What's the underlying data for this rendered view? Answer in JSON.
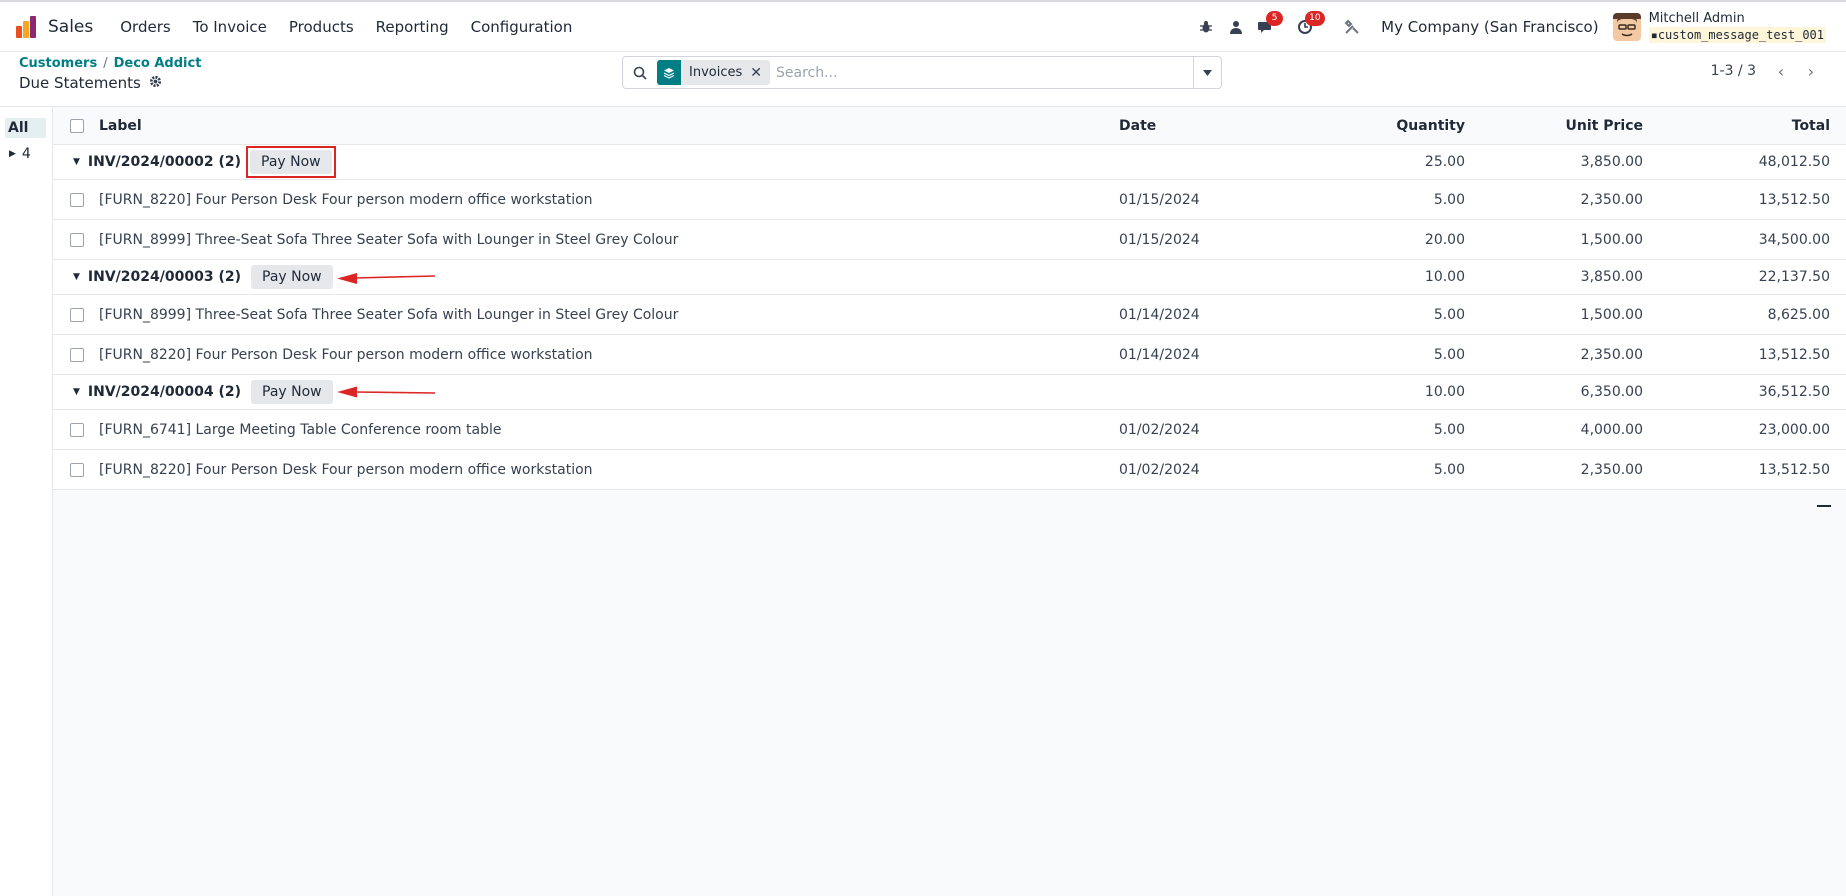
{
  "navbar": {
    "app_name": "Sales",
    "menu": [
      "Orders",
      "To Invoice",
      "Products",
      "Reporting",
      "Configuration"
    ],
    "messages_badge": "5",
    "activities_badge": "10",
    "company": "My Company (San Francisco)",
    "user_name": "Mitchell Admin",
    "database": "custom_message_test_001"
  },
  "control": {
    "breadcrumb": [
      "Customers",
      "Deco Addict"
    ],
    "title": "Due Statements",
    "facet_label": "Invoices",
    "search_placeholder": "Search...",
    "pager": "1-3 / 3"
  },
  "side": {
    "all_label": "All",
    "items": [
      "4"
    ]
  },
  "table": {
    "headers": {
      "label": "Label",
      "date": "Date",
      "quantity": "Quantity",
      "unit_price": "Unit Price",
      "total": "Total"
    },
    "pay_label": "Pay Now",
    "groups": [
      {
        "name": "INV/2024/00002 (2)",
        "quantity": "25.00",
        "unit_price": "3,850.00",
        "total": "48,012.50",
        "rows": [
          {
            "label": "[FURN_8220] Four Person Desk Four person modern office workstation",
            "date": "01/15/2024",
            "quantity": "5.00",
            "unit_price": "2,350.00",
            "total": "13,512.50"
          },
          {
            "label": "[FURN_8999] Three-Seat Sofa Three Seater Sofa with Lounger in Steel Grey Colour",
            "date": "01/15/2024",
            "quantity": "20.00",
            "unit_price": "1,500.00",
            "total": "34,500.00"
          }
        ]
      },
      {
        "name": "INV/2024/00003 (2)",
        "quantity": "10.00",
        "unit_price": "3,850.00",
        "total": "22,137.50",
        "rows": [
          {
            "label": "[FURN_8999] Three-Seat Sofa Three Seater Sofa with Lounger in Steel Grey Colour",
            "date": "01/14/2024",
            "quantity": "5.00",
            "unit_price": "1,500.00",
            "total": "8,625.00"
          },
          {
            "label": "[FURN_8220] Four Person Desk Four person modern office workstation",
            "date": "01/14/2024",
            "quantity": "5.00",
            "unit_price": "2,350.00",
            "total": "13,512.50"
          }
        ]
      },
      {
        "name": "INV/2024/00004 (2)",
        "quantity": "10.00",
        "unit_price": "6,350.00",
        "total": "36,512.50",
        "rows": [
          {
            "label": "[FURN_6741] Large Meeting Table Conference room table",
            "date": "01/02/2024",
            "quantity": "5.00",
            "unit_price": "4,000.00",
            "total": "23,000.00"
          },
          {
            "label": "[FURN_8220] Four Person Desk Four person modern office workstation",
            "date": "01/02/2024",
            "quantity": "5.00",
            "unit_price": "2,350.00",
            "total": "13,512.50"
          }
        ]
      }
    ]
  },
  "colors": {
    "accent": "#017e84",
    "badge": "#dc2626",
    "annotation": "#dc2626"
  }
}
